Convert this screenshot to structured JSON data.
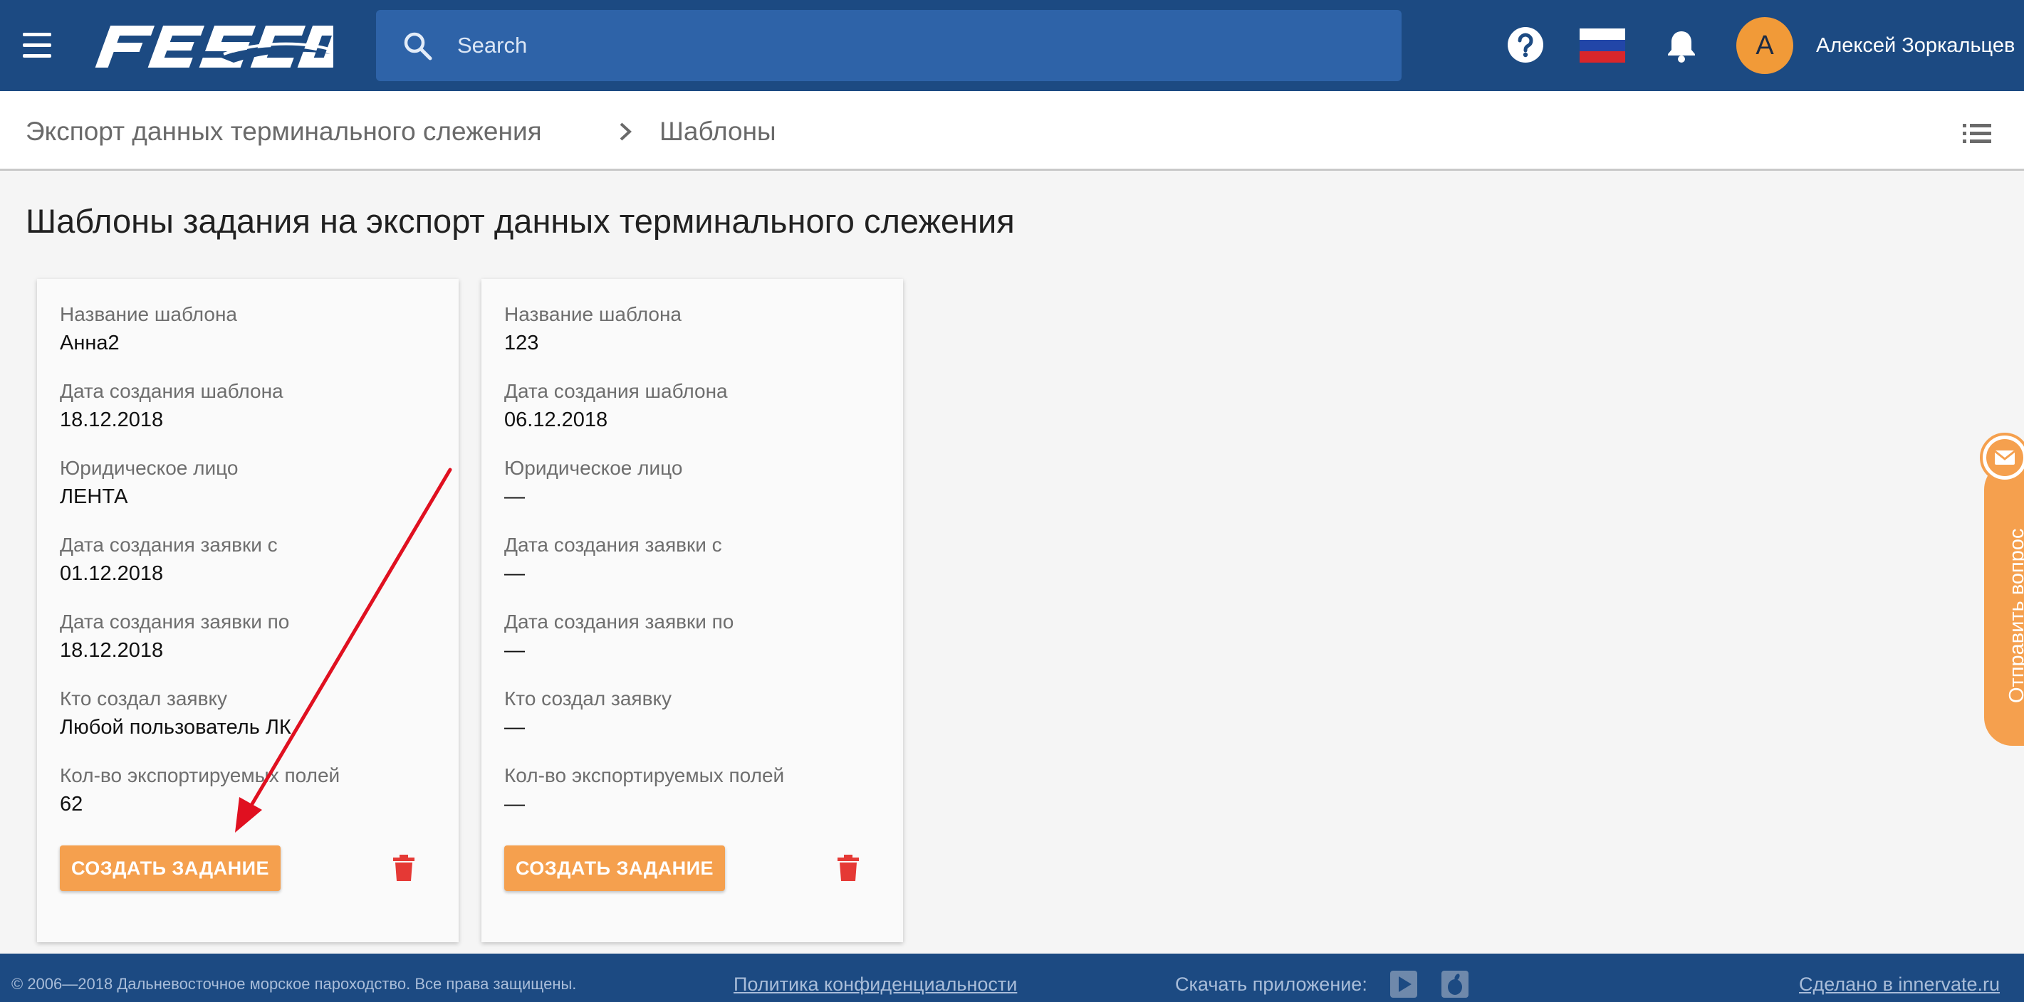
{
  "header": {
    "logo_text": "FESCO",
    "search_placeholder": "Search",
    "user_initial": "A",
    "user_name": "Алексей Зоркальцев"
  },
  "breadcrumb": {
    "items": [
      "Экспорт данных терминального слежения",
      "Шаблоны"
    ]
  },
  "page": {
    "title": "Шаблоны задания на экспорт данных терминального слежения"
  },
  "cards": [
    {
      "fields": [
        {
          "label": "Название шаблона",
          "value": "Анна2"
        },
        {
          "label": "Дата создания шаблона",
          "value": "18.12.2018"
        },
        {
          "label": "Юридическое лицо",
          "value": "ЛЕНТА"
        },
        {
          "label": "Дата создания заявки с",
          "value": "01.12.2018"
        },
        {
          "label": "Дата создания заявки по",
          "value": "18.12.2018"
        },
        {
          "label": "Кто создал заявку",
          "value": "Любой пользователь ЛК"
        },
        {
          "label": "Кол-во экспортируемых полей",
          "value": "62"
        }
      ],
      "create_label": "СОЗДАТЬ ЗАДАНИЕ"
    },
    {
      "fields": [
        {
          "label": "Название шаблона",
          "value": "123"
        },
        {
          "label": "Дата создания шаблона",
          "value": "06.12.2018"
        },
        {
          "label": "Юридическое лицо",
          "value": "—"
        },
        {
          "label": "Дата создания заявки с",
          "value": "—"
        },
        {
          "label": "Дата создания заявки по",
          "value": "—"
        },
        {
          "label": "Кто создал заявку",
          "value": "—"
        },
        {
          "label": "Кол-во экспортируемых полей",
          "value": "—"
        }
      ],
      "create_label": "СОЗДАТЬ ЗАДАНИЕ"
    }
  ],
  "feedback": {
    "label": "Отправить вопрос"
  },
  "footer": {
    "copyright": "© 2006—2018  Дальневосточное морское пароходство. Все права защищены.",
    "privacy_link": "Политика конфиденциальности",
    "download_label": "Скачать приложение:",
    "made_by_link": "Сделано в innervate.ru"
  },
  "colors": {
    "header_bg": "#1c4a82",
    "accent_orange": "#f5a04e",
    "delete_red": "#e53935",
    "annotation_arrow": "#e01020"
  }
}
